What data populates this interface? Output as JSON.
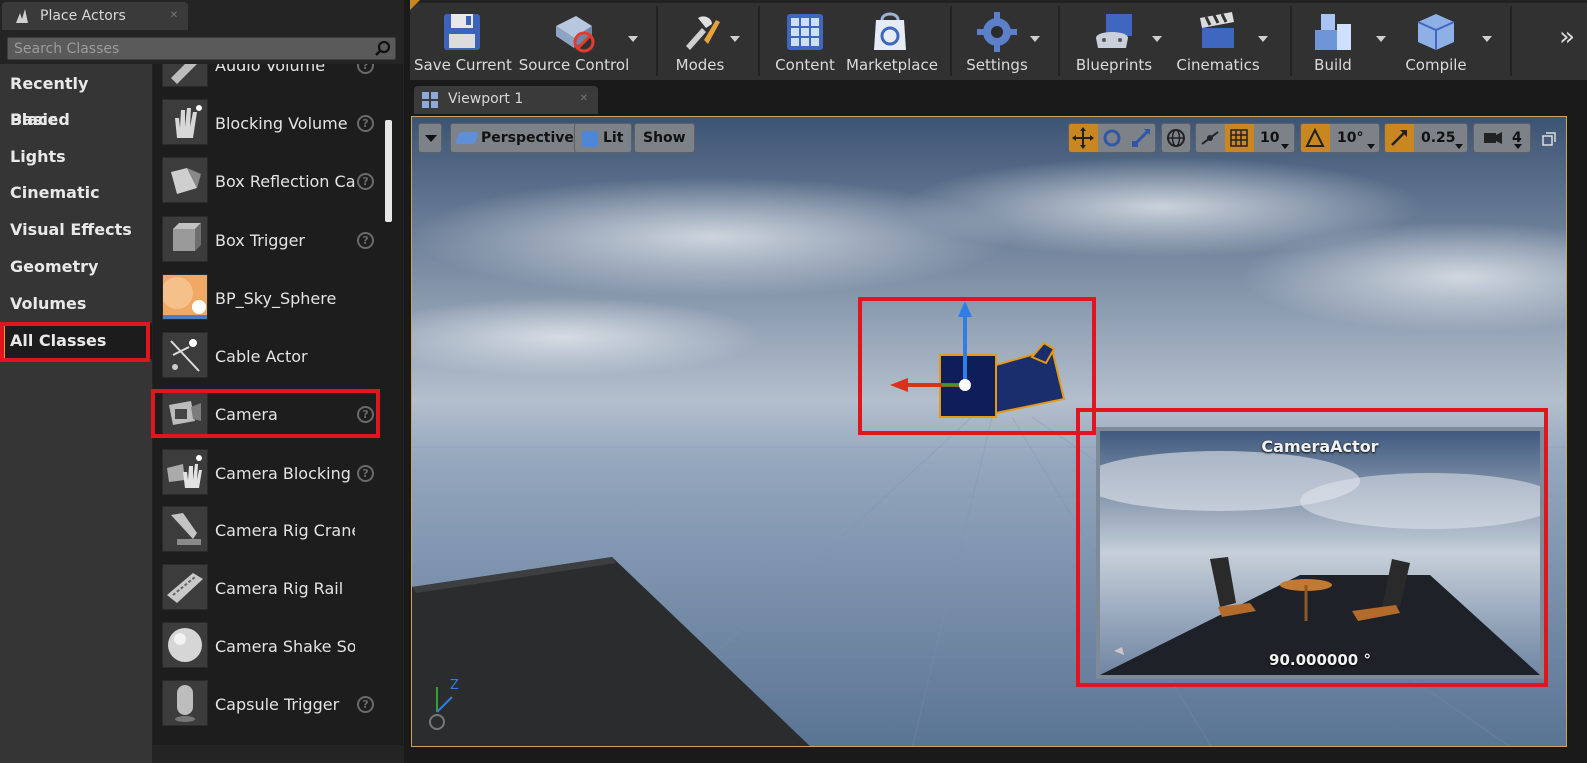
{
  "place_actors": {
    "tab_title": "Place Actors",
    "search_placeholder": "Search Classes",
    "categories": [
      {
        "label": "Recently Placed"
      },
      {
        "label": "Basic"
      },
      {
        "label": "Lights"
      },
      {
        "label": "Cinematic"
      },
      {
        "label": "Visual Effects"
      },
      {
        "label": "Geometry"
      },
      {
        "label": "Volumes"
      },
      {
        "label": "All Classes",
        "active": true
      }
    ],
    "items": [
      {
        "label": "Audio Volume",
        "icon": "audio-volume-icon",
        "help": true
      },
      {
        "label": "Blocking Volume",
        "icon": "blocking-volume-icon",
        "help": true
      },
      {
        "label": "Box Reflection Ca",
        "icon": "box-reflection-capture-icon",
        "help": true
      },
      {
        "label": "Box Trigger",
        "icon": "box-trigger-icon",
        "help": true
      },
      {
        "label": "BP_Sky_Sphere",
        "icon": "sky-sphere-icon",
        "help": false
      },
      {
        "label": "Cable Actor",
        "icon": "cable-actor-icon",
        "help": false
      },
      {
        "label": "Camera",
        "icon": "camera-icon",
        "help": true
      },
      {
        "label": "Camera Blocking ",
        "icon": "camera-blocking-icon",
        "help": true
      },
      {
        "label": "Camera Rig Crane",
        "icon": "camera-rig-crane-icon",
        "help": false
      },
      {
        "label": "Camera Rig Rail",
        "icon": "camera-rig-rail-icon",
        "help": false
      },
      {
        "label": "Camera Shake Sourc",
        "icon": "camera-shake-icon",
        "help": false
      },
      {
        "label": "Capsule Trigger",
        "icon": "capsule-trigger-icon",
        "help": true
      }
    ]
  },
  "toolbar": {
    "buttons": [
      {
        "label": "Save Current",
        "icon": "save-icon"
      },
      {
        "label": "Source Control",
        "icon": "source-control-icon"
      },
      {
        "label": "Modes",
        "icon": "modes-icon"
      },
      {
        "label": "Content",
        "icon": "content-icon"
      },
      {
        "label": "Marketplace",
        "icon": "marketplace-icon"
      },
      {
        "label": "Settings",
        "icon": "settings-icon"
      },
      {
        "label": "Blueprints",
        "icon": "blueprints-icon"
      },
      {
        "label": "Cinematics",
        "icon": "cinematics-icon"
      },
      {
        "label": "Build",
        "icon": "build-icon"
      },
      {
        "label": "Compile",
        "icon": "compile-icon"
      }
    ],
    "more": "»"
  },
  "viewport": {
    "tab_title": "Viewport 1",
    "perspective": "Perspective",
    "lit": "Lit",
    "show": "Show",
    "grid_snap": "10",
    "rotation_snap": "10°",
    "scale_snap": "0.25",
    "camera_speed": "4",
    "preview_title": "CameraActor",
    "preview_fov": "90.000000 °",
    "axis_z": "Z",
    "accent_color": "#c88720",
    "highlight_color": "#e0161e"
  }
}
